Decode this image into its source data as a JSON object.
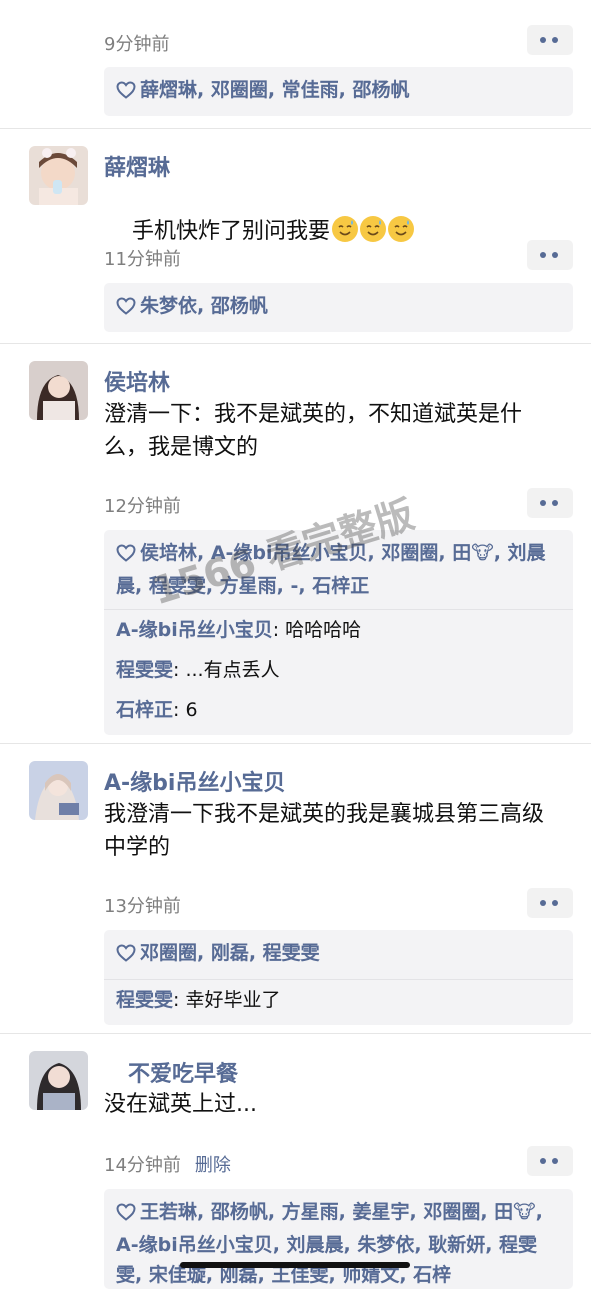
{
  "posts": [
    {
      "time": "9分钟前",
      "likes": "薛熠琳, 邓圈圈, 常佳雨, 邵杨帆"
    },
    {
      "name": "薛熠琳",
      "text": "手机快炸了别问我要",
      "emoji_count": 3,
      "time": "11分钟前",
      "likes": "朱梦依, 邵杨帆"
    },
    {
      "name": "侯培林",
      "text": "澄清一下：我不是斌英的，不知道斌英是什么，我是博文的",
      "time": "12分钟前",
      "likes": "侯培林, A-缘bi吊丝小宝贝, 邓圈圈, 田🐮, 刘晨晨, 程雯雯, 方星雨, -, 石梓正",
      "comments": [
        {
          "who": "A-缘bi吊丝小宝贝",
          "text": ": 哈哈哈哈"
        },
        {
          "who": "程雯雯",
          "text": ": ...有点丢人"
        },
        {
          "who": "石梓正",
          "text": ": 6"
        }
      ]
    },
    {
      "name": "A-缘bi吊丝小宝贝",
      "text": "我澄清一下我不是斌英的我是襄城县第三高级中学的",
      "time": "13分钟前",
      "likes": "邓圈圈, 刚磊, 程雯雯",
      "comments": [
        {
          "who": "程雯雯",
          "text": ": 幸好毕业了"
        }
      ]
    },
    {
      "name": "不爱吃早餐",
      "text": "没在斌英上过...",
      "time": "14分钟前",
      "delete_label": "删除",
      "likes": "王若琳, 邵杨帆, 方星雨, 姜星宇, 邓圈圈, 田🐮, A-缘bi吊丝小宝贝, 刘晨晨, 朱梦依, 耿新妍, 程雯雯, 宋佳璇, 刚磊, 王佳雯, 师婧文, 石梓"
    }
  ],
  "watermark": "1566 看完整版"
}
